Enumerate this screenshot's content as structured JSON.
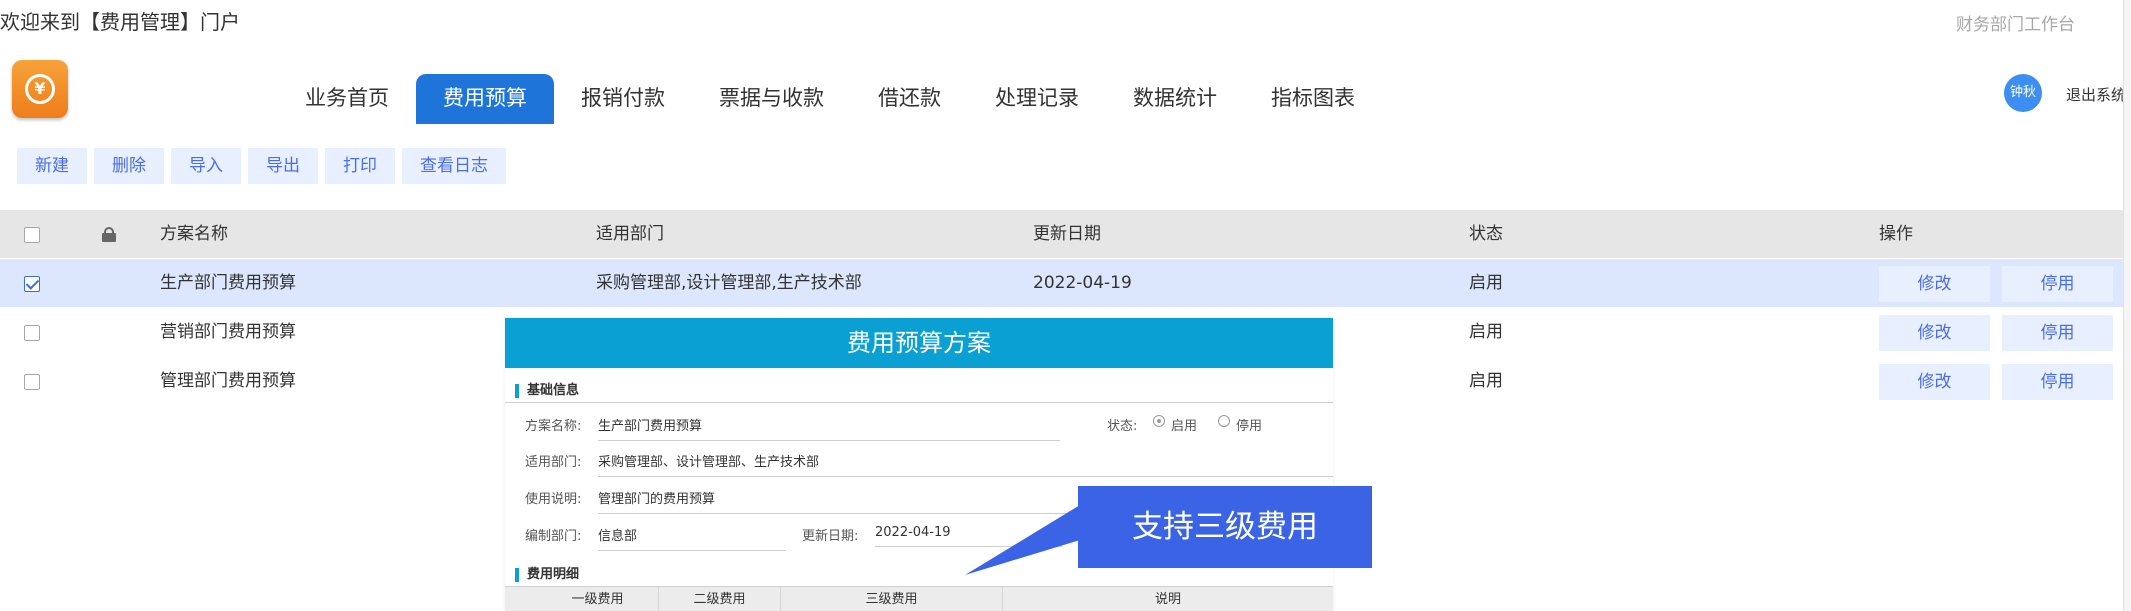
{
  "header": {
    "welcome": "欢迎来到【费用管理】门户",
    "portal": "财务部门工作台",
    "logo_symbol": "¥",
    "user": "钟秋",
    "logout": "退出系统"
  },
  "nav": {
    "items": [
      "业务首页",
      "费用预算",
      "报销付款",
      "票据与收款",
      "借还款",
      "处理记录",
      "数据统计",
      "指标图表"
    ],
    "active": "费用预算"
  },
  "toolbar": {
    "new": "新建",
    "delete": "删除",
    "import": "导入",
    "export": "导出",
    "print": "打印",
    "log": "查看日志"
  },
  "table": {
    "columns": {
      "name": "方案名称",
      "dept": "适用部门",
      "date": "更新日期",
      "status": "状态",
      "ops": "操作"
    },
    "rows": [
      {
        "name": "生产部门费用预算",
        "dept": "采购管理部,设计管理部,生产技术部",
        "date": "2022-04-19",
        "status": "启用",
        "edit": "修改",
        "disable": "停用",
        "checked": true
      },
      {
        "name": "营销部门费用预算",
        "dept": "",
        "date": "",
        "status": "启用",
        "edit": "修改",
        "disable": "停用",
        "checked": false
      },
      {
        "name": "管理部门费用预算",
        "dept": "",
        "date": "",
        "status": "启用",
        "edit": "修改",
        "disable": "停用",
        "checked": false
      }
    ]
  },
  "form": {
    "title": "费用预算方案",
    "basic_section": "基础信息",
    "plan_name_label": "方案名称:",
    "plan_name": "生产部门费用预算",
    "status_label": "状态:",
    "status_on": "启用",
    "status_off": "停用",
    "status_selected": "启用",
    "dept_label": "适用部门:",
    "dept": "采购管理部、设计管理部、生产技术部",
    "usage_label": "使用说明:",
    "usage": "管理部门的费用预算",
    "author_dept_label": "编制部门:",
    "author_dept": "信息部",
    "update_label": "更新日期:",
    "update_date": "2022-04-19",
    "detail_section": "费用明细",
    "detail_columns": [
      "一级费用",
      "二级费用",
      "三级费用",
      "说明"
    ]
  },
  "callout": {
    "text": "支持三级费用",
    "color": "#3a63e6"
  },
  "colors": {
    "nav_active": "#1e74d8",
    "form_title_bg": "#0aa0d4",
    "button_bg": "#e8efff",
    "button_text": "#4a6ee8",
    "logo": "#f29030"
  }
}
